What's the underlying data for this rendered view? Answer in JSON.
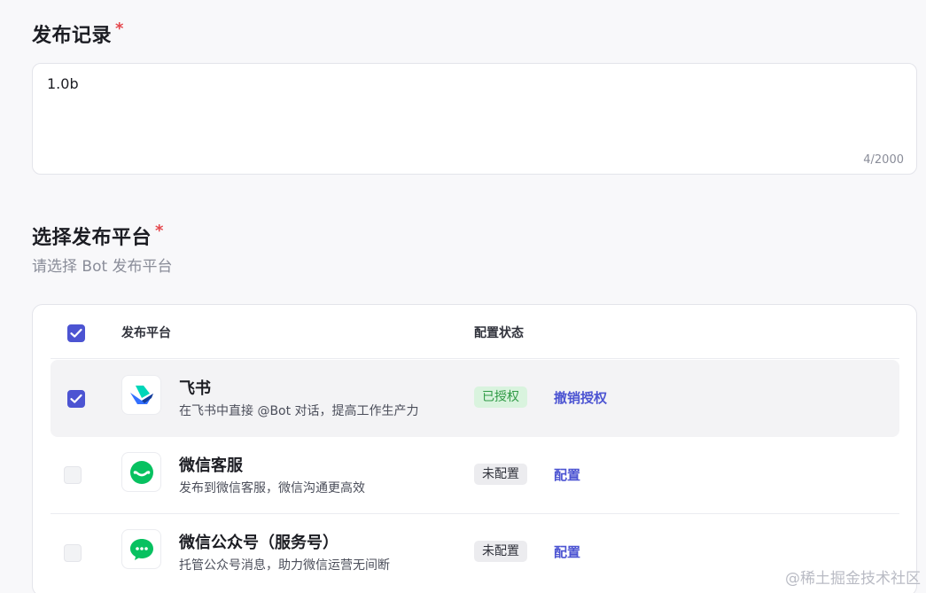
{
  "release_record": {
    "title": "发布记录",
    "required_mark": "*",
    "value": "1.0b",
    "counter": "4/2000"
  },
  "platform_select": {
    "title": "选择发布平台",
    "required_mark": "*",
    "subtitle": "请选择 Bot 发布平台",
    "columns": {
      "platform": "发布平台",
      "status": "配置状态"
    },
    "header_checkbox_checked": true,
    "rows": [
      {
        "name": "飞书",
        "description": "在飞书中直接 @Bot 对话，提高工作生产力",
        "status": "已授权",
        "action": "撤销授权",
        "checked": true,
        "icon": "feishu-logo"
      },
      {
        "name": "微信客服",
        "description": "发布到微信客服，微信沟通更高效",
        "status": "未配置",
        "action": "配置",
        "checked": false,
        "icon": "wechat-customer-service-logo"
      },
      {
        "name": "微信公众号（服务号）",
        "description": "托管公众号消息，助力微信运营无间断",
        "status": "未配置",
        "action": "配置",
        "checked": false,
        "icon": "wechat-official-account-logo"
      }
    ]
  },
  "watermark": "@稀土掘金技术社区",
  "colors": {
    "accent": "#4c54d2",
    "authorized_bg": "#d9f3de",
    "authorized_text": "#2f9a45",
    "required": "#e5484d",
    "wechat_green": "#07c160"
  }
}
